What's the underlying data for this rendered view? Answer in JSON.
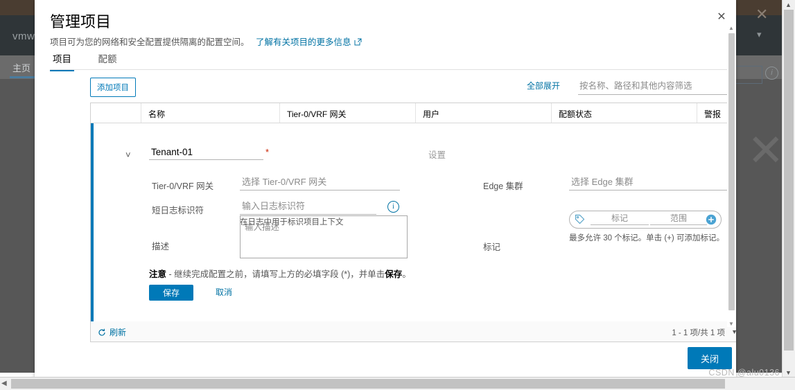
{
  "background_app": {
    "logo": "vmw",
    "nav_tab": "主页"
  },
  "modal": {
    "title": "管理项目",
    "subtitle": "项目可为您的网络和安全配置提供隔离的配置空间。",
    "subtitle_link": "了解有关项目的更多信息",
    "close_icon": "close-icon",
    "tabs": [
      {
        "label": "项目",
        "active": true
      },
      {
        "label": "配额",
        "active": false
      }
    ],
    "toolbar": {
      "add_button": "添加项目",
      "expand_all": "全部展开",
      "search_placeholder": "按名称、路径和其他内容筛选",
      "search_value": "",
      "filter_icon": "filter-icon"
    },
    "table": {
      "columns": [
        "",
        "名称",
        "Tier-0/VRF 网关",
        "用户",
        "配额状态",
        "警报"
      ],
      "row": {
        "expand_icon": "chevron-down-icon",
        "name_value": "Tenant-01",
        "required_marker": "*",
        "settings_label": "设置",
        "fields": {
          "tier0_label": "Tier-0/VRF 网关",
          "tier0_placeholder": "选择 Tier-0/VRF 网关",
          "tier0_value": "",
          "edge_label": "Edge 集群",
          "edge_placeholder": "选择 Edge 集群",
          "edge_value": "",
          "short_log_label": "短日志标识符",
          "short_log_placeholder": "输入日志标识符",
          "short_log_value": "",
          "short_log_helper": "在日志中用于标识项目上下文",
          "short_log_info_icon": "info-icon",
          "description_label": "描述",
          "description_placeholder": "输入描述",
          "description_value": "",
          "tags_label": "标记",
          "tag_icon": "tag-icon",
          "tag_key_placeholder": "标记",
          "tag_key_value": "",
          "tag_scope_placeholder": "范围",
          "tag_scope_value": "",
          "tag_add_icon": "add-circle-icon",
          "tags_helper": "最多允许 30 个标记。单击 (+) 可添加标记。"
        },
        "note_prefix": "注意",
        "note_text": " - 继续完成配置之前，请填写上方的必填字段 (*)，并单击",
        "note_bold_tail": "保存",
        "note_suffix": "。",
        "save_button": "保存",
        "cancel_button": "取消"
      },
      "footer": {
        "refresh_icon": "refresh-icon",
        "refresh_label": "刷新",
        "pagination": "1 - 1 项/共 1 项",
        "pagination_caret": "chevron-down-icon"
      }
    },
    "footer": {
      "close_button": "关闭"
    }
  },
  "watermark": "CSDN @alu0136",
  "colors": {
    "accent": "#0079b8",
    "link": "#0072a3",
    "required": "#c92100",
    "topbar": "#4a3d31",
    "navbar": "#2f3538",
    "backdrop": "#575757"
  }
}
